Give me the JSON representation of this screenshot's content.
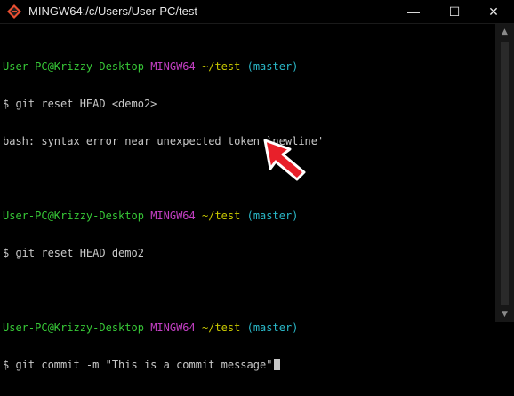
{
  "window": {
    "title": "MINGW64:/c/Users/User-PC/test",
    "minimize_glyph": "—",
    "maximize_glyph": "☐",
    "close_glyph": "✕"
  },
  "terminal": {
    "prompts": [
      {
        "user": "User-PC@Krizzy-Desktop",
        "host": "MINGW64",
        "path": "~/test",
        "branch": "(master)"
      },
      {
        "user": "User-PC@Krizzy-Desktop",
        "host": "MINGW64",
        "path": "~/test",
        "branch": "(master)"
      },
      {
        "user": "User-PC@Krizzy-Desktop",
        "host": "MINGW64",
        "path": "~/test",
        "branch": "(master)"
      }
    ],
    "commands": [
      "$ git reset HEAD <demo2>",
      "$ git reset HEAD demo2",
      "$ git commit -m \"This is a commit message\""
    ],
    "outputs": [
      "bash: syntax error near unexpected token `newline'"
    ]
  },
  "scrollbar": {
    "up_glyph": "▲",
    "down_glyph": "▼"
  },
  "colors": {
    "background": "#000000",
    "user": "#37c837",
    "host": "#c33fc3",
    "path": "#c8c800",
    "branch": "#2ab8c8",
    "text": "#c8c8c8",
    "annotation_arrow": "#e8202a"
  },
  "icons": {
    "app": "git-bash-icon",
    "annotation": "red-pointer-arrow-icon"
  }
}
